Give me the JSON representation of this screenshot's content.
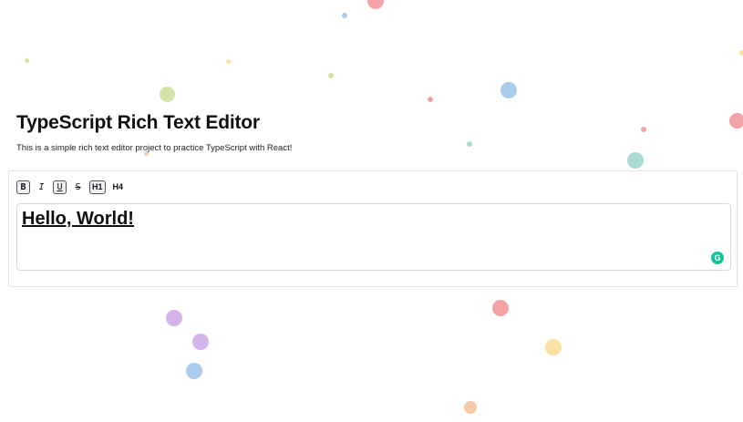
{
  "header": {
    "title": "TypeScript Rich Text Editor",
    "subtitle": "This is a simple rich text editor project to practice TypeScript with React!"
  },
  "toolbar": {
    "buttons": [
      {
        "label": "B",
        "icon": "bold-icon",
        "active": true
      },
      {
        "label": "I",
        "icon": "italic-icon",
        "active": false
      },
      {
        "label": "U",
        "icon": "underline-icon",
        "active": true
      },
      {
        "label": "S",
        "icon": "strikethrough-icon",
        "active": false
      },
      {
        "label": "H1",
        "icon": "heading1-icon",
        "active": true
      },
      {
        "label": "H4",
        "icon": "heading4-icon",
        "active": false
      }
    ]
  },
  "editor": {
    "content": "Hello, World!"
  },
  "grammarly": {
    "label": "G",
    "color": "#15c39a"
  },
  "colors": {
    "dot_red": "#f3a3a6",
    "dot_blue": "#a9cdea",
    "dot_green": "#d4e4a8",
    "dot_yellow": "#f9e2a3",
    "dot_purple": "#d3b4ea",
    "dot_teal": "#a9dcd6",
    "dot_orange": "#f7c9a8"
  }
}
